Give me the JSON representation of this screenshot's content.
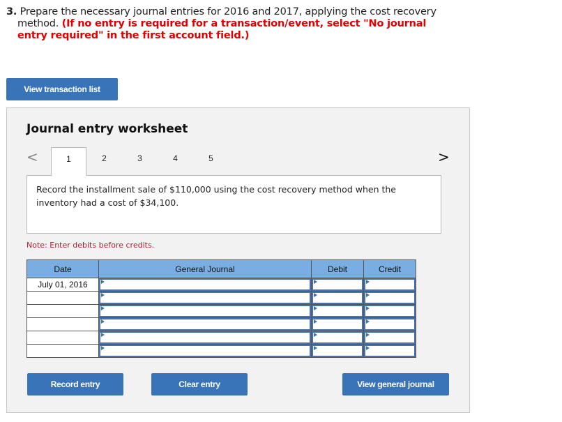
{
  "question": {
    "number": "3.",
    "text_line1": "Prepare the necessary journal entries for 2016 and 2017, applying the cost recovery",
    "text_line2_plain": "method.",
    "instruction": "(If no entry is required for a transaction/event, select \"No journal entry required\" in the first account field.)"
  },
  "buttons": {
    "view_transaction_list": "View transaction list",
    "record_entry": "Record entry",
    "clear_entry": "Clear entry",
    "view_general_journal": "View general journal"
  },
  "worksheet": {
    "title": "Journal entry worksheet",
    "nav_prev_icon": "chevron-left-icon",
    "nav_next_icon": "chevron-right-icon",
    "prev_glyph": "<",
    "next_glyph": ">",
    "tabs": [
      {
        "label": "1",
        "active": true
      },
      {
        "label": "2",
        "active": false
      },
      {
        "label": "3",
        "active": false
      },
      {
        "label": "4",
        "active": false
      },
      {
        "label": "5",
        "active": false
      }
    ],
    "prompt": "Record the installment sale of $110,000 using the cost recovery method when the inventory had a cost of $34,100.",
    "note": "Note: Enter debits before credits."
  },
  "journal": {
    "headers": {
      "date": "Date",
      "account": "General Journal",
      "debit": "Debit",
      "credit": "Credit"
    },
    "rows": [
      {
        "date": "July 01, 2016",
        "account": "",
        "debit": "",
        "credit": ""
      },
      {
        "date": "",
        "account": "",
        "debit": "",
        "credit": ""
      },
      {
        "date": "",
        "account": "",
        "debit": "",
        "credit": ""
      },
      {
        "date": "",
        "account": "",
        "debit": "",
        "credit": ""
      },
      {
        "date": "",
        "account": "",
        "debit": "",
        "credit": ""
      },
      {
        "date": "",
        "account": "",
        "debit": "",
        "credit": ""
      }
    ]
  },
  "colors": {
    "button_blue": "#3a74b8",
    "header_blue": "#7aaee3",
    "instruction_red": "#e00000",
    "note_red": "#b01c2e",
    "panel_bg": "#f2f2f2"
  }
}
